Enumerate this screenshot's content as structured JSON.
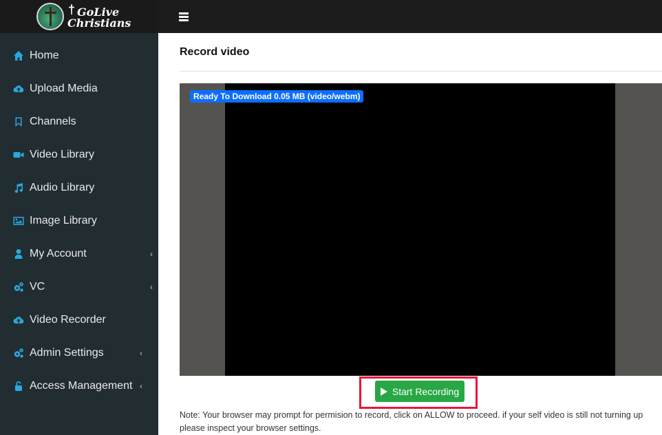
{
  "logo": {
    "line1": "GoLive",
    "line2": "Christians"
  },
  "sidebar": {
    "items": [
      {
        "label": "Home",
        "icon": "home-icon",
        "chevron": false
      },
      {
        "label": "Upload Media",
        "icon": "cloud-upload-icon",
        "chevron": false
      },
      {
        "label": "Channels",
        "icon": "bookmark-icon",
        "chevron": false
      },
      {
        "label": "Video Library",
        "icon": "video-camera-icon",
        "chevron": false
      },
      {
        "label": "Audio Library",
        "icon": "music-note-icon",
        "chevron": false
      },
      {
        "label": "Image Library",
        "icon": "image-icon",
        "chevron": false
      },
      {
        "label": "My Account",
        "icon": "user-icon",
        "chevron": true
      },
      {
        "label": "VC",
        "icon": "gears-icon",
        "chevron": true
      },
      {
        "label": "Video Recorder",
        "icon": "cloud-upload-icon",
        "chevron": false
      },
      {
        "label": "Admin Settings",
        "icon": "gears-icon",
        "chevron": true
      },
      {
        "label": "Access Management",
        "icon": "unlock-icon",
        "chevron": true
      }
    ]
  },
  "main": {
    "title": "Record video",
    "badge": "Ready To Download 0.05 MB (video/webm)",
    "record_button": "Start Recording",
    "note": "Note: Your browser may prompt for permision to record, click on ALLOW to proceed. if your self video is still not turning up please inspect your browser settings."
  },
  "colors": {
    "sidebar_bg": "#222d32",
    "icon_accent": "#26a9e0",
    "record_button": "#28a745",
    "highlight_frame": "#e8173a",
    "badge": "#0d6efd"
  }
}
